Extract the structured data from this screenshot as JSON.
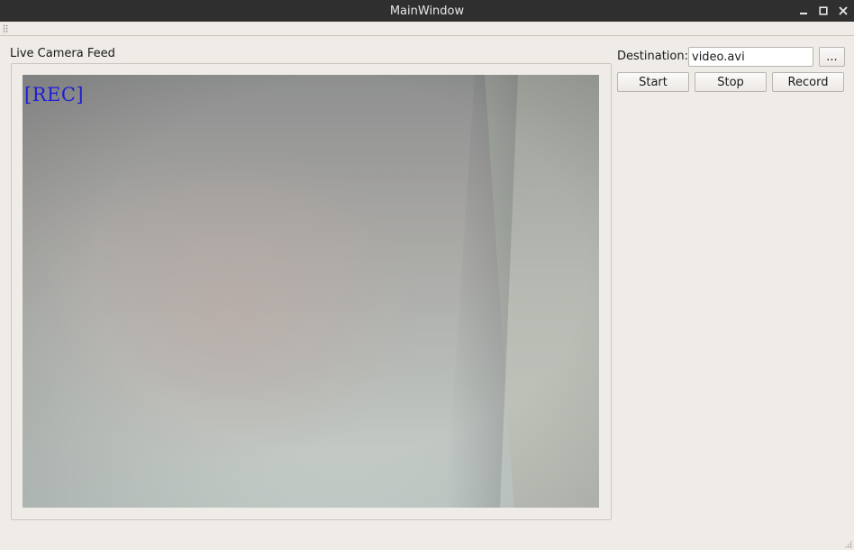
{
  "window": {
    "title": "MainWindow"
  },
  "camera": {
    "group_title": "Live Camera Feed",
    "overlay_text": "[REC]"
  },
  "destination": {
    "label": "Destination:",
    "value": "video.avi",
    "browse_label": "..."
  },
  "controls": {
    "start_label": "Start",
    "stop_label": "Stop",
    "record_label": "Record"
  },
  "colors": {
    "titlebar": "#2f2f2f",
    "window_bg": "#efebe7",
    "rec_overlay": "#1e1ed8"
  },
  "icons": {
    "minimize": "minimize-icon",
    "maximize": "maximize-icon",
    "close": "close-icon"
  }
}
